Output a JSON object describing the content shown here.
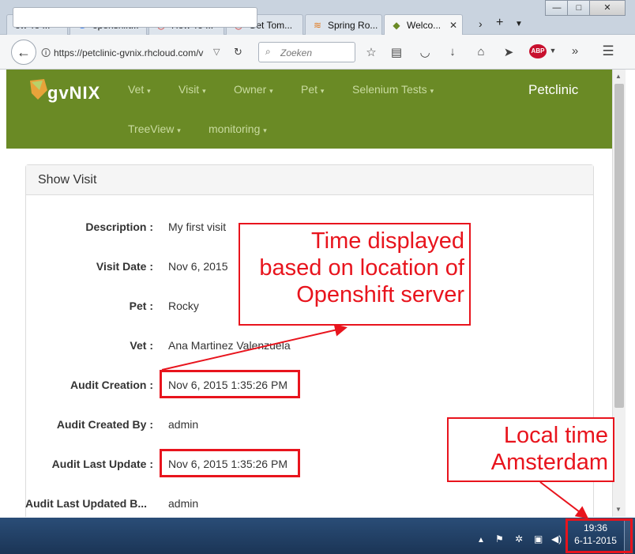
{
  "browser": {
    "tabs": [
      {
        "label": "ow To ...",
        "icon": "page-icon"
      },
      {
        "label": "openshift...",
        "icon": "google-g-icon"
      },
      {
        "label": "How To ...",
        "icon": "openshift-icon"
      },
      {
        "label": "Get Tom...",
        "icon": "openshift-icon"
      },
      {
        "label": "Spring Ro...",
        "icon": "stack-icon"
      },
      {
        "label": "Welco...",
        "icon": "gvnix-icon",
        "active": true
      }
    ],
    "url": "https://petclinic-gvnix.rhcloud.com/v",
    "search_placeholder": "Zoeken",
    "window_buttons": {
      "minimize": "—",
      "maximize": "□",
      "close": "✕"
    }
  },
  "app": {
    "logo_text": "gvNIX",
    "brand": "Petclinic",
    "menu": [
      "Vet",
      "Visit",
      "Owner",
      "Pet",
      "Selenium Tests",
      "TreeView",
      "monitoring"
    ],
    "accent_color": "#6a8a25"
  },
  "panel": {
    "title": "Show Visit",
    "rows": [
      {
        "label": "Description :",
        "value": "My first visit"
      },
      {
        "label": "Visit Date :",
        "value": "Nov 6, 2015"
      },
      {
        "label": "Pet :",
        "value": "Rocky"
      },
      {
        "label": "Vet :",
        "value": "Ana Martinez Valenzuela"
      },
      {
        "label": "Audit Creation :",
        "value": "Nov 6, 2015 1:35:26 PM"
      },
      {
        "label": "Audit Created By :",
        "value": "admin"
      },
      {
        "label": "Audit Last Update :",
        "value": "Nov 6, 2015 1:35:26 PM"
      },
      {
        "label": "Audit Last Updated B...",
        "value": "admin"
      }
    ]
  },
  "annotations": {
    "server_time": [
      "Time displayed",
      "based on location of",
      "Openshift server"
    ],
    "local_time": [
      "Local time",
      "Amsterdam"
    ],
    "color": "#e8141d"
  },
  "taskbar": {
    "time": "19:36",
    "date": "6-11-2015"
  }
}
